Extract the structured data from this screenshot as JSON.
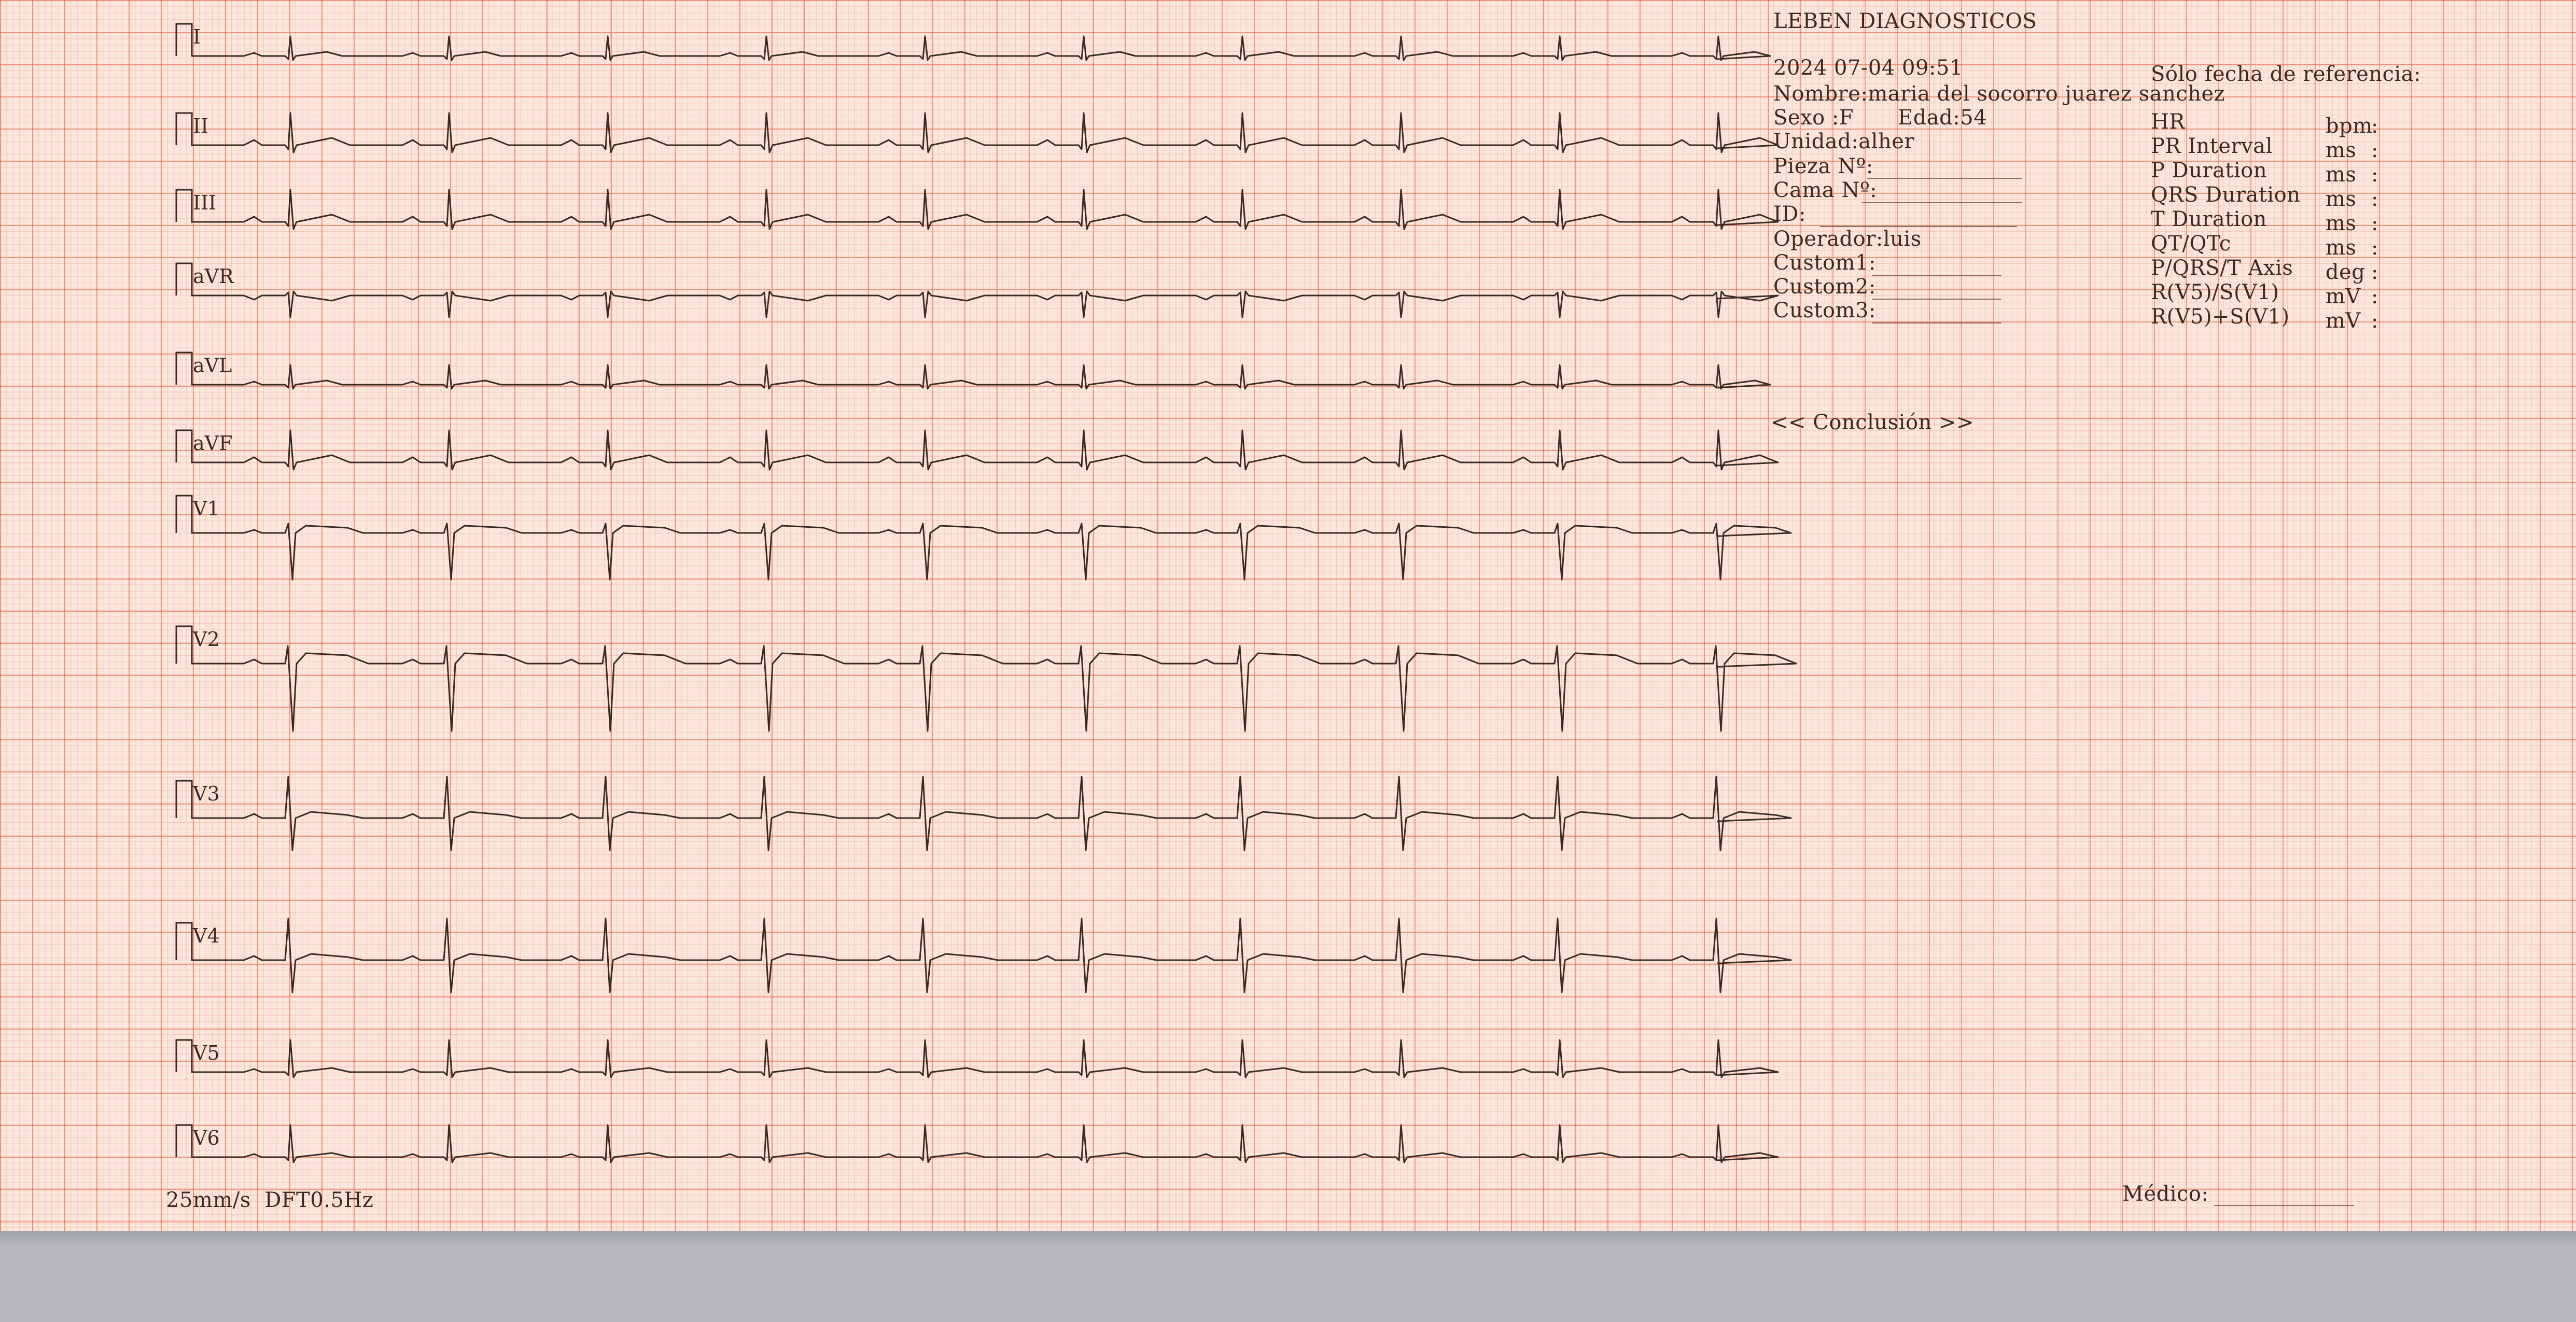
{
  "header": {
    "lab": "LEBEN DIAGNOSTICOS",
    "datetime": "2024 07-04 09:51",
    "reference_only": "Sólo fecha de referencia:"
  },
  "patient": {
    "nombre": "Nombre:maria del socorro juarez sanchez",
    "sexo": "Sexo :F",
    "edad": "Edad:54",
    "unidad": "Unidad:alher",
    "pieza": "Pieza Nº:",
    "cama": "Cama Nº:",
    "id": "ID:",
    "operador": "Operador:luis",
    "custom1": "Custom1:",
    "custom2": "Custom2:",
    "custom3": "Custom3:"
  },
  "measurements": [
    {
      "label": "HR",
      "unit": "bpm",
      "sep": ":"
    },
    {
      "label": "PR Interval",
      "unit": "ms",
      "sep": ":"
    },
    {
      "label": "P Duration",
      "unit": "ms",
      "sep": ":"
    },
    {
      "label": "QRS Duration",
      "unit": "ms",
      "sep": ":"
    },
    {
      "label": "T Duration",
      "unit": "ms",
      "sep": ":"
    },
    {
      "label": "QT/QTc",
      "unit": "ms",
      "sep": ":"
    },
    {
      "label": "P/QRS/T Axis",
      "unit": "deg",
      "sep": ":"
    },
    {
      "label": "R(V5)/S(V1)",
      "unit": "mV",
      "sep": ":"
    },
    {
      "label": "R(V5)+S(V1)",
      "unit": "mV",
      "sep": ":"
    }
  ],
  "conclusion": "<< Conclusión >>",
  "footer": {
    "speed_filter": "25mm/s  DFT0.5Hz",
    "medico": "Médico:"
  },
  "leads": [
    {
      "name": "I",
      "shape": "small"
    },
    {
      "name": "II",
      "shape": "upright"
    },
    {
      "name": "III",
      "shape": "upright"
    },
    {
      "name": "aVR",
      "shape": "inverted"
    },
    {
      "name": "aVL",
      "shape": "small"
    },
    {
      "name": "aVF",
      "shape": "upright"
    },
    {
      "name": "V1",
      "shape": "deep-s"
    },
    {
      "name": "V2",
      "shape": "deep-s-large"
    },
    {
      "name": "V3",
      "shape": "biphasic"
    },
    {
      "name": "V4",
      "shape": "biphasic"
    },
    {
      "name": "V5",
      "shape": "tall-r"
    },
    {
      "name": "V6",
      "shape": "tall-r"
    }
  ],
  "colors": {
    "trace": "#3a2a24",
    "grid_major": "#e25c3a",
    "grid_minor": "#ec8468",
    "paper": "#fbe6dd"
  }
}
